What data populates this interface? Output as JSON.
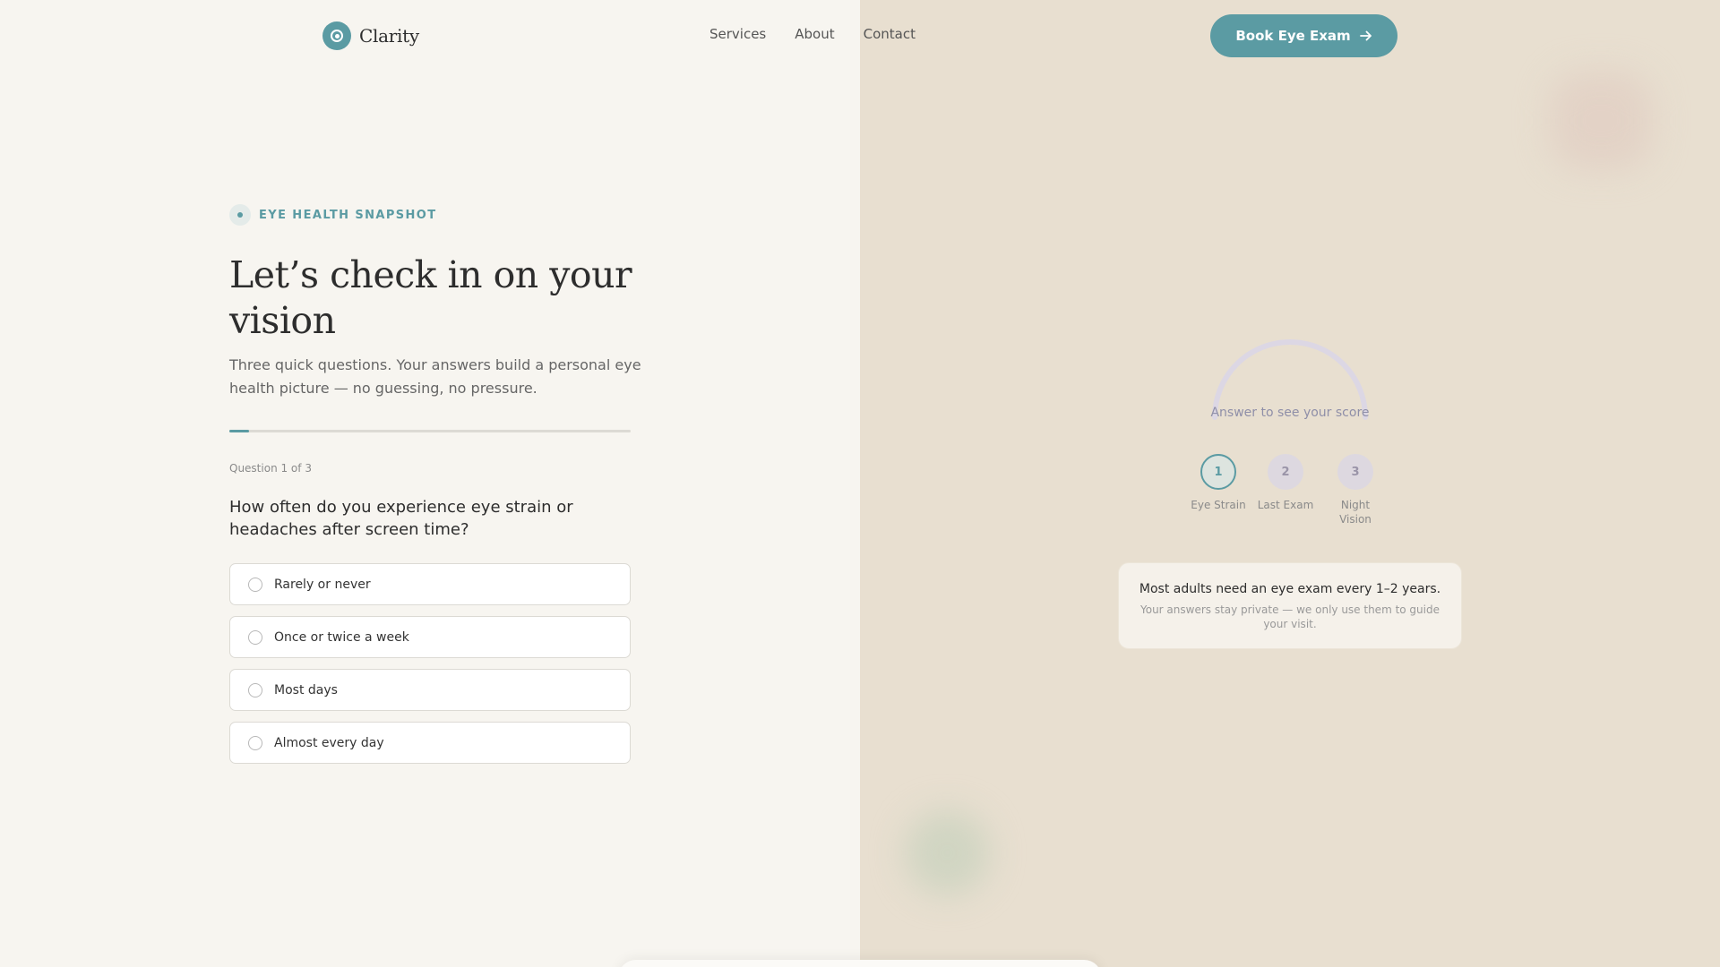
{
  "header": {
    "brand": "Clarity",
    "nav": [
      {
        "label": "Services"
      },
      {
        "label": "About"
      },
      {
        "label": "Contact"
      }
    ],
    "cta_label": "Book Eye Exam"
  },
  "intro": {
    "eyebrow": "EYE HEALTH SNAPSHOT",
    "headline": "Let’s check in on your vision",
    "subtitle": "Three quick questions. Your answers build a personal eye health picture — no guessing, no pressure."
  },
  "quiz": {
    "counter": "Question 1 of 3",
    "progress_fraction": 0.05,
    "question": "How often do you experience eye strain or headaches after screen time?",
    "options": [
      {
        "label": "Rarely or never"
      },
      {
        "label": "Once or twice a week"
      },
      {
        "label": "Most days"
      },
      {
        "label": "Almost every day"
      }
    ]
  },
  "score_panel": {
    "caption": "Answer to see your score",
    "steps": [
      {
        "number": "1",
        "label": "Eye Strain",
        "active": true
      },
      {
        "number": "2",
        "label": "Last Exam",
        "active": false
      },
      {
        "number": "3",
        "label": "Night Vision",
        "active": false
      }
    ],
    "info_title": "Most adults need an eye exam every 1–2 years.",
    "info_note": "Your answers stay private — we only use them to guide your visit."
  },
  "colors": {
    "accent": "#5b9ba3",
    "left_bg": "#f7f5f0",
    "right_bg": "#e8dfd0"
  }
}
